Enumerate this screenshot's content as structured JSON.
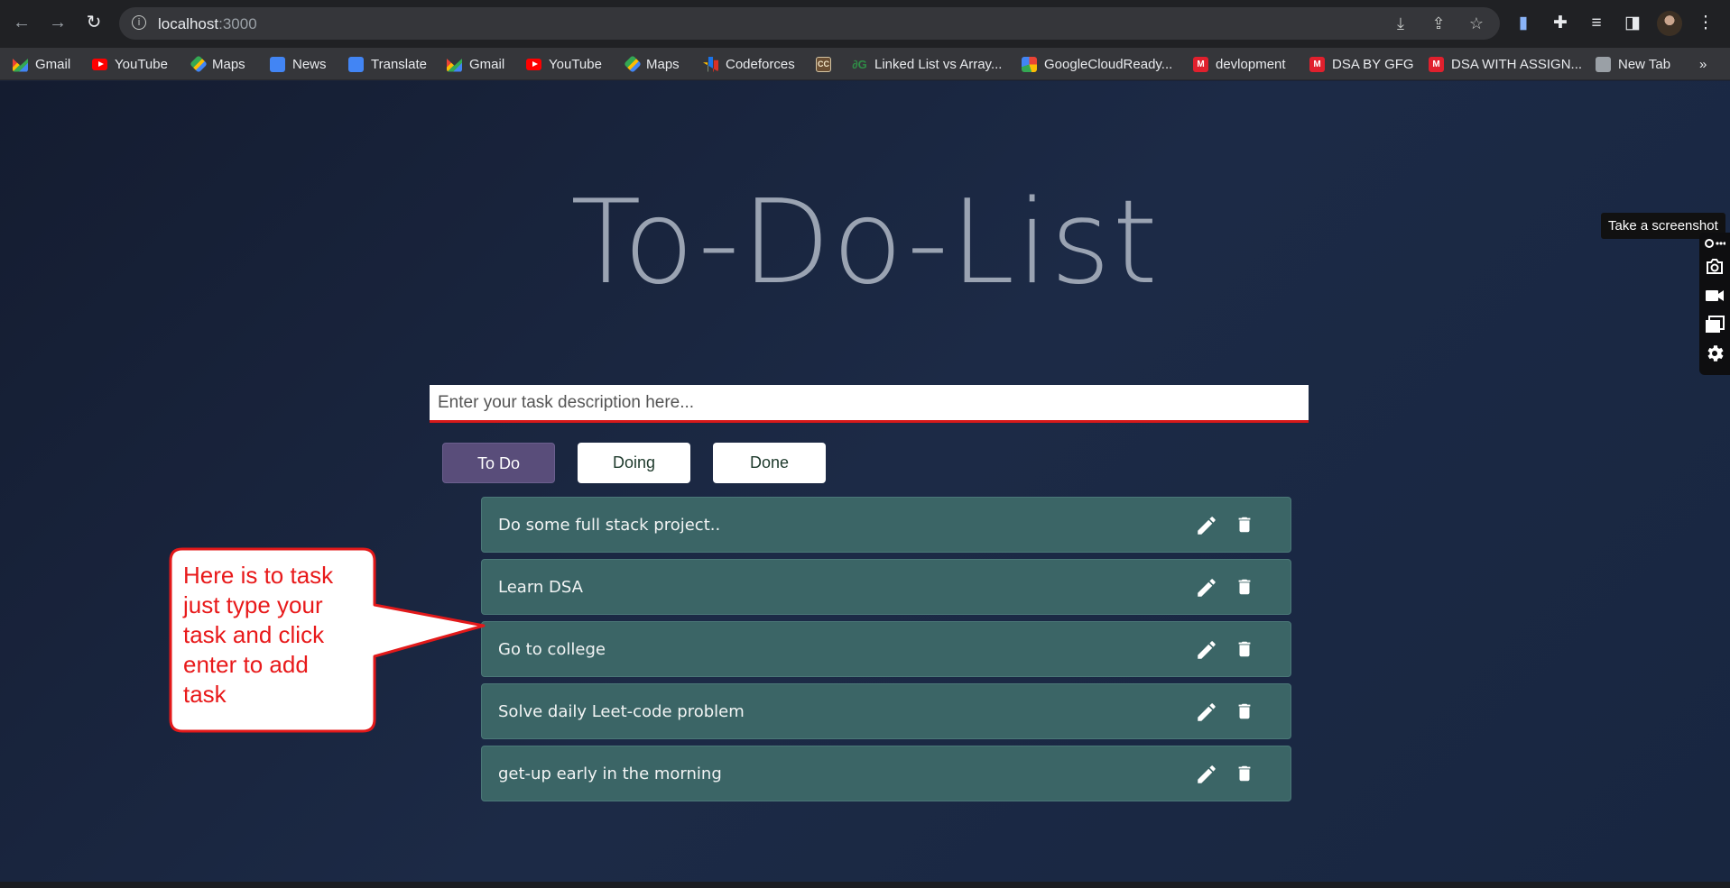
{
  "browser": {
    "url_host": "localhost",
    "url_port": ":3000",
    "bookmarks": [
      {
        "label": "Gmail",
        "icon": "gmail-icon"
      },
      {
        "label": "YouTube",
        "icon": "youtube-icon"
      },
      {
        "label": "Maps",
        "icon": "maps-icon"
      },
      {
        "label": "News",
        "icon": "news-icon"
      },
      {
        "label": "Translate",
        "icon": "translate-icon"
      },
      {
        "label": "Gmail",
        "icon": "gmail-icon"
      },
      {
        "label": "YouTube",
        "icon": "youtube-icon"
      },
      {
        "label": "Maps",
        "icon": "maps-icon"
      },
      {
        "label": "Codeforces",
        "icon": "codeforces-icon"
      },
      {
        "label": "",
        "icon": "codechef-icon"
      },
      {
        "label": "Linked List vs Array...",
        "icon": "geeksforgeeks-icon"
      },
      {
        "label": "GoogleCloudReady...",
        "icon": "google-icon"
      },
      {
        "label": "devlopment",
        "icon": "mega-icon"
      },
      {
        "label": "DSA BY GFG",
        "icon": "mega-icon"
      },
      {
        "label": "DSA WITH ASSIGN...",
        "icon": "mega-icon"
      },
      {
        "label": "New Tab",
        "icon": "globe-icon"
      }
    ],
    "more_bookmarks": "»"
  },
  "app": {
    "title": "To-Do-List",
    "input_placeholder": "Enter your task description here...",
    "filters": [
      {
        "label": "To Do",
        "active": true
      },
      {
        "label": "Doing",
        "active": false
      },
      {
        "label": "Done",
        "active": false
      }
    ],
    "tasks": [
      {
        "text": "Do some full stack project.."
      },
      {
        "text": "Learn DSA"
      },
      {
        "text": "Go to college"
      },
      {
        "text": "Solve daily Leet-code problem"
      },
      {
        "text": "get-up early in the morning"
      }
    ]
  },
  "callout": {
    "lines": [
      "Here is to task",
      "just type your",
      "task and click",
      "enter to add",
      "task"
    ]
  },
  "extension": {
    "tooltip": "Take a screenshot"
  },
  "colors": {
    "accent_active": "#594d7a",
    "task_row": "#3b6566",
    "input_underline": "#d6191a",
    "callout_text": "#e8191a"
  }
}
